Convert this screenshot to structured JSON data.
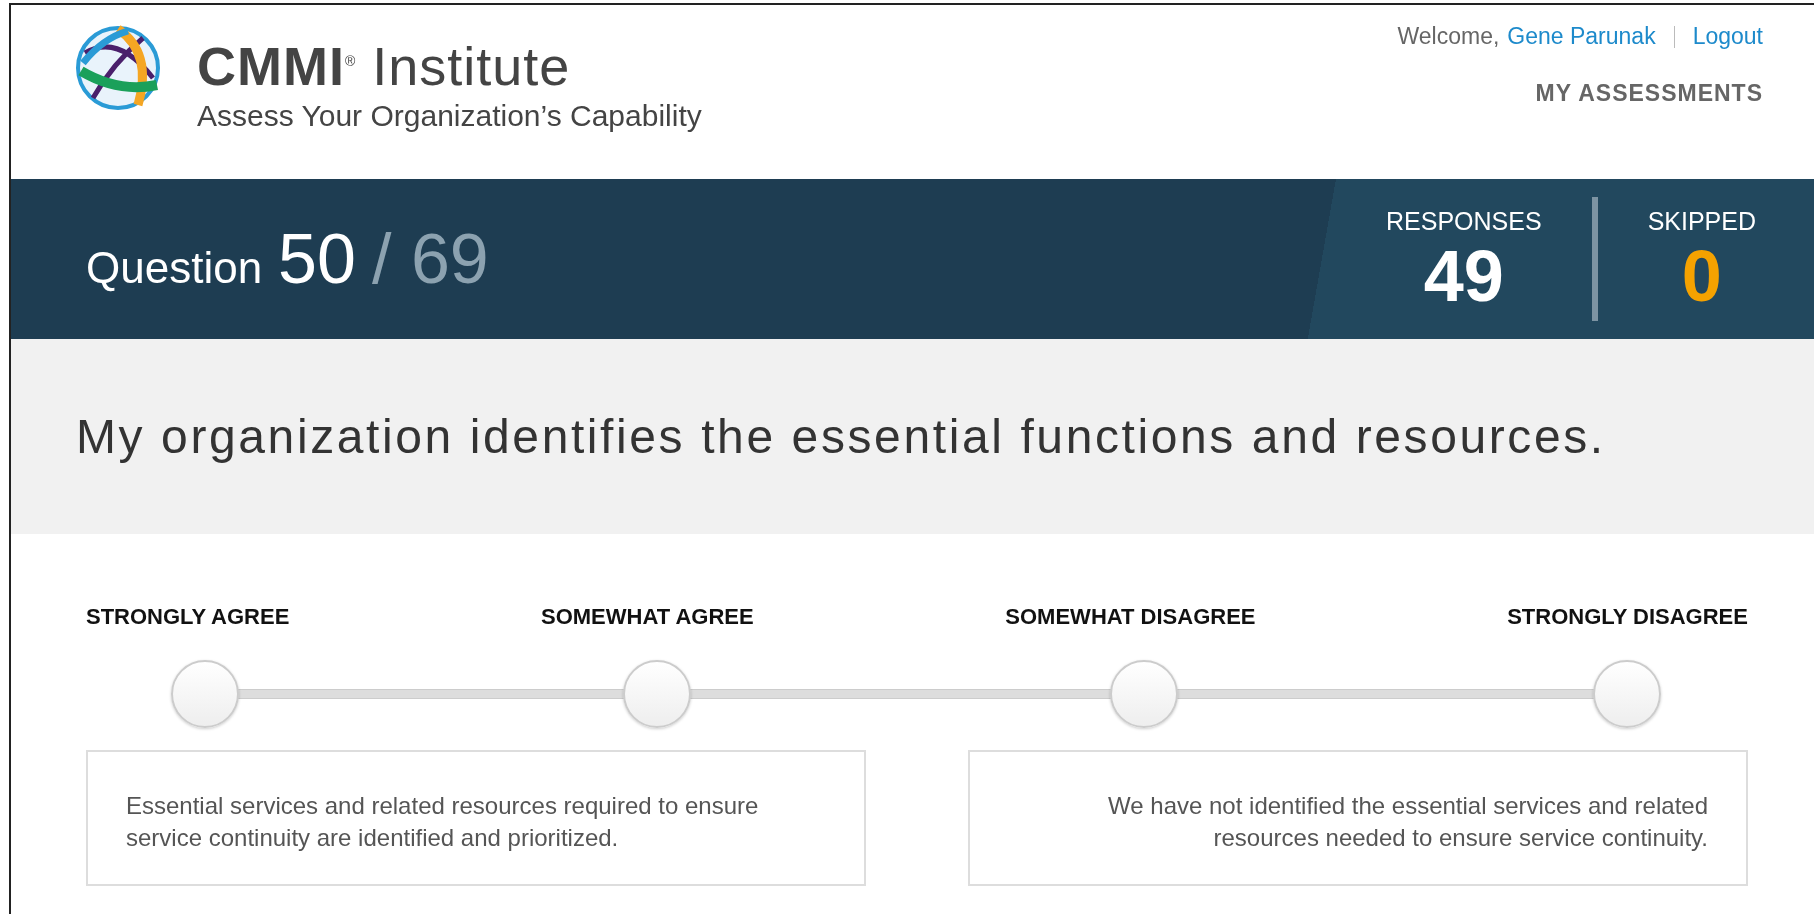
{
  "header": {
    "brand": "**CMMI**$^{®}$ Institute",
    "tagline": "Assess Your Organization’s Capability",
    "welcome": "Welcome,",
    "user": "Gene Parunak",
    "logout": "Logout",
    "nav": "MY ASSESSMENTS"
  },
  "progress": {
    "label": "Question",
    "current": "50",
    "total": "/ 69"
  },
  "stats": [
    {
      "kind": "responses",
      "label": "RESPONSES",
      "value": "49"
    },
    {
      "kind": "skipped",
      "label": "SKIPPED",
      "value": "0"
    }
  ],
  "question": "My organization identifies the essential functions and resources.",
  "options": [
    {
      "label": "STRONGLY AGREE",
      "selected": false,
      "description": "Essential services and related resources required to ensure service continuity are identified and prioritized."
    },
    {
      "label": "SOMEWHAT AGREE",
      "selected": false
    },
    {
      "label": "SOMEWHAT DISAGREE",
      "selected": false
    },
    {
      "label": "STRONGLY DISAGREE",
      "selected": false,
      "description": "We have not identified the essential services and related resources needed to ensure service continuity."
    }
  ]
}
